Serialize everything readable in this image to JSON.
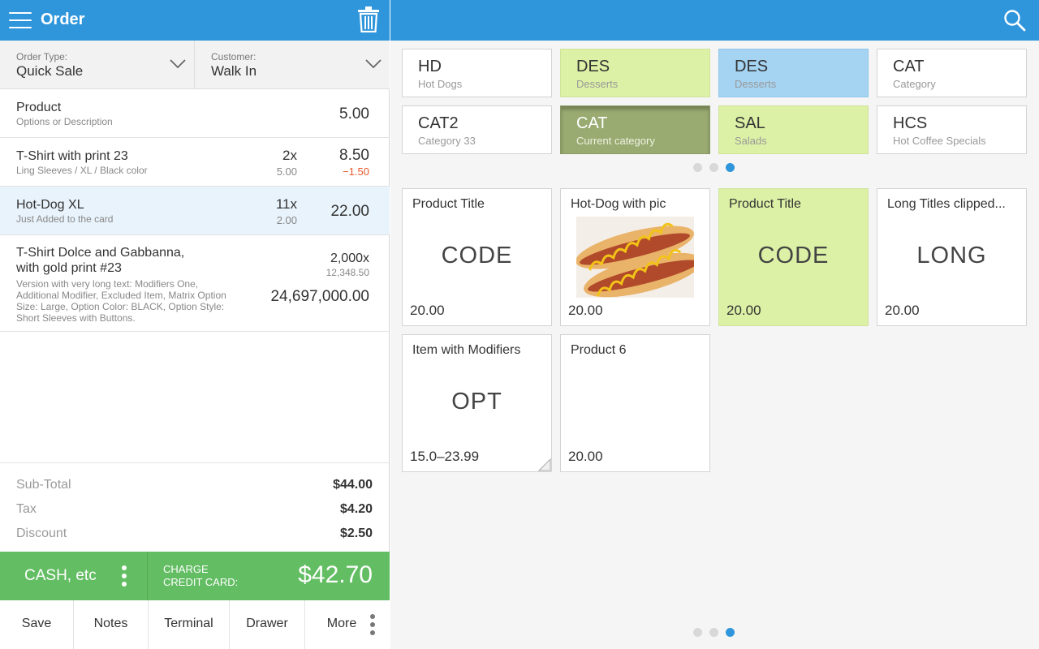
{
  "header": {
    "title": "Order",
    "menu_icon": "hamburger-menu-icon",
    "trash_icon": "trash-icon",
    "search_icon": "search-icon"
  },
  "order_type": {
    "label": "Order Type:",
    "value": "Quick Sale"
  },
  "customer": {
    "label": "Customer:",
    "value": "Walk In"
  },
  "line_items": [
    {
      "name": "Product",
      "description": "Options or Description",
      "qty": "",
      "unit_price": "",
      "total": "5.00",
      "discount": ""
    },
    {
      "name": "T-Shirt with print 23",
      "description": "Ling Sleeves / XL / Black color",
      "qty": "2x",
      "unit_price": "5.00",
      "total": "8.50",
      "discount": "−1.50"
    },
    {
      "name": "Hot-Dog XL",
      "description": "Just Added to the card",
      "qty": "11x",
      "unit_price": "2.00",
      "total": "22.00",
      "discount": "",
      "selected": true
    },
    {
      "name": "T-Shirt Dolce and Gabbanna,",
      "name2": "with gold print #23",
      "description": "Version with very long text: Modifiers One,",
      "description2": "Additional Modifier, Excluded Item, Matrix Option",
      "description3": "Size: Large, Option Color: BLACK, Option Style:",
      "description4": "Short Sleeves with Buttons.",
      "qty": "2,000x",
      "unit_price": "12,348.50",
      "total": "24,697,000.00",
      "discount": ""
    }
  ],
  "totals": {
    "subtotal_label": "Sub-Total",
    "subtotal": "$44.00",
    "tax_label": "Tax",
    "tax": "$4.20",
    "discount_label": "Discount",
    "discount": "$2.50"
  },
  "payment": {
    "cash_label": "CASH, etc",
    "charge_line1": "CHARGE",
    "charge_line2": "CREDIT CARD:",
    "amount": "$42.70"
  },
  "actions": [
    "Save",
    "Notes",
    "Terminal",
    "Drawer",
    "More"
  ],
  "categories": [
    {
      "code": "HD",
      "name": "Hot Dogs",
      "style": "white"
    },
    {
      "code": "DES",
      "name": "Desserts",
      "style": "green"
    },
    {
      "code": "DES",
      "name": "Desserts",
      "style": "blue"
    },
    {
      "code": "CAT",
      "name": "Category",
      "style": "white"
    },
    {
      "code": "CAT2",
      "name": "Category 33",
      "style": "white"
    },
    {
      "code": "CAT",
      "name": "Current category",
      "style": "olive"
    },
    {
      "code": "SAL",
      "name": "Salads",
      "style": "green"
    },
    {
      "code": "HCS",
      "name": "Hot Coffee Specials",
      "style": "white"
    }
  ],
  "category_pager": {
    "pages": 3,
    "current": 3
  },
  "products": [
    {
      "title": "Product Title",
      "code": "CODE",
      "price": "20.00",
      "style": "white"
    },
    {
      "title": "Hot-Dog with pic",
      "code": "",
      "price": "20.00",
      "style": "white",
      "image": "hot-dog-image"
    },
    {
      "title": "Product Title",
      "code": "CODE",
      "price": "20.00",
      "style": "green"
    },
    {
      "title": "Long Titles clipped...",
      "code": "LONG",
      "price": "20.00",
      "style": "white"
    },
    {
      "title": "Item with Modifiers",
      "code": "OPT",
      "price": "15.0–23.99",
      "style": "white",
      "has_modifiers": true
    },
    {
      "title": "Product 6",
      "code": "",
      "price": "20.00",
      "style": "white"
    }
  ],
  "product_pager": {
    "pages": 3,
    "current": 3
  },
  "colors": {
    "header_blue": "#2f96dc",
    "pay_green": "#63bd63",
    "cat_green": "#dcf1a6",
    "cat_blue": "#a5d4f2",
    "cat_olive": "#9aab71",
    "discount_red": "#e8582a"
  }
}
